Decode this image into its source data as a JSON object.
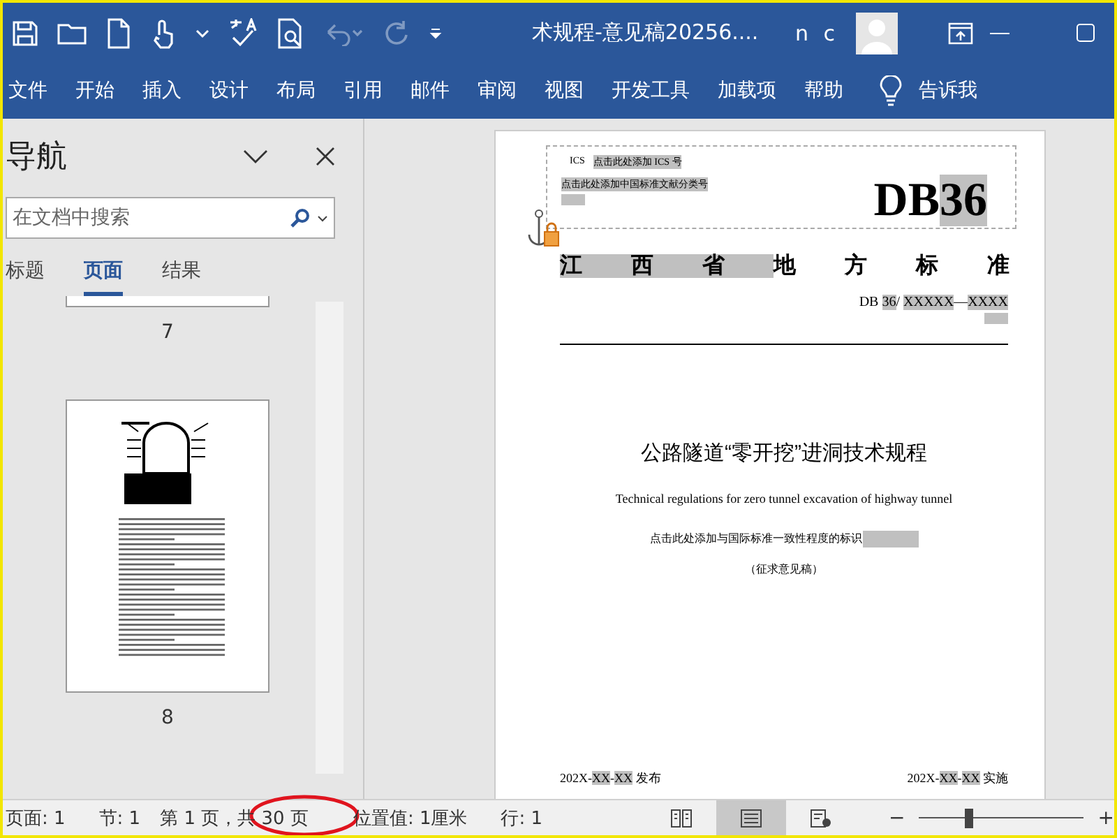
{
  "title_bar": {
    "title": "术规程-意见稿20256....",
    "user": "n c",
    "undo_disabled": true,
    "redo_disabled": true
  },
  "ribbon": {
    "tabs": [
      "文件",
      "开始",
      "插入",
      "设计",
      "布局",
      "引用",
      "邮件",
      "审阅",
      "视图",
      "开发工具",
      "加载项",
      "帮助"
    ],
    "tell_me": "告诉我"
  },
  "navigation": {
    "title": "导航",
    "search": {
      "placeholder": "在文档中搜索"
    },
    "tabs": [
      {
        "label": "标题",
        "selected": false
      },
      {
        "label": "页面",
        "selected": true
      },
      {
        "label": "结果",
        "selected": false
      }
    ],
    "pages": [
      {
        "number": "7"
      },
      {
        "number": "8"
      }
    ]
  },
  "document": {
    "ics_label": "ICS",
    "ics_placeholder": "点击此处添加 ICS 号",
    "ccs_placeholder": "点击此处添加中国标准文献分类号",
    "logo": [
      {
        "text": "DB",
        "highlighted": false
      },
      {
        "text": "36",
        "highlighted": true
      }
    ],
    "standard_type": [
      {
        "text": "江西省",
        "highlighted": true
      },
      {
        "text": "地方标准",
        "highlighted": false
      }
    ],
    "number": [
      {
        "text": "DB ",
        "highlighted": false
      },
      {
        "text": "36",
        "highlighted": true
      },
      {
        "text": "/ ",
        "highlighted": false
      },
      {
        "text": "XXXXX",
        "highlighted": true
      },
      {
        "text": "—",
        "highlighted": false
      },
      {
        "text": "XXXX",
        "highlighted": true
      }
    ],
    "title": "公路隧道“零开挖”进洞技术规程",
    "title_en": "Technical regulations for zero tunnel excavation of highway tunnel",
    "consistency": "点击此处添加与国际标准一致性程度的标识",
    "stage": "（征求意见稿）",
    "issue_date": [
      {
        "text": "202X-",
        "highlighted": false
      },
      {
        "text": "XX",
        "highlighted": true
      },
      {
        "text": "-",
        "highlighted": false
      },
      {
        "text": "XX",
        "highlighted": true
      },
      {
        "text": " 发布",
        "highlighted": false
      }
    ],
    "effective_date": [
      {
        "text": "202X-",
        "highlighted": false
      },
      {
        "text": "XX",
        "highlighted": true
      },
      {
        "text": "-",
        "highlighted": false
      },
      {
        "text": "XX",
        "highlighted": true
      },
      {
        "text": " 实施",
        "highlighted": false
      }
    ]
  },
  "status_bar": {
    "items": [
      "页面: 1",
      "节: 1",
      "第 1 页，共 30 页",
      "位置值: 1厘米",
      "行: 1"
    ],
    "views": [
      {
        "selected": false
      },
      {
        "selected": true
      },
      {
        "selected": false
      }
    ],
    "zoom": {
      "out": "−",
      "in": "+",
      "level": 0.3
    }
  }
}
